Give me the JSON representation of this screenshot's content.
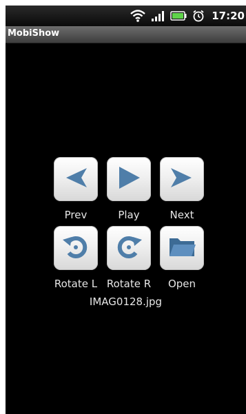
{
  "status_bar": {
    "icons": [
      "wifi-icon",
      "signal-icon",
      "battery-icon",
      "alarm-icon"
    ],
    "time": "17:20"
  },
  "app": {
    "title": "MobiShow"
  },
  "controls": {
    "prev": {
      "label": "Prev",
      "icon": "arrow-left-icon"
    },
    "play": {
      "label": "Play",
      "icon": "play-icon"
    },
    "next": {
      "label": "Next",
      "icon": "arrow-right-icon"
    },
    "rotate_left": {
      "label": "Rotate L",
      "icon": "rotate-left-icon"
    },
    "rotate_right": {
      "label": "Rotate R",
      "icon": "rotate-right-icon"
    },
    "open": {
      "label": "Open",
      "icon": "folder-icon"
    }
  },
  "current_file": "IMAG0128.jpg",
  "colors": {
    "icon_blue": "#4f7ea9",
    "status_battery": "#5fd34a"
  }
}
